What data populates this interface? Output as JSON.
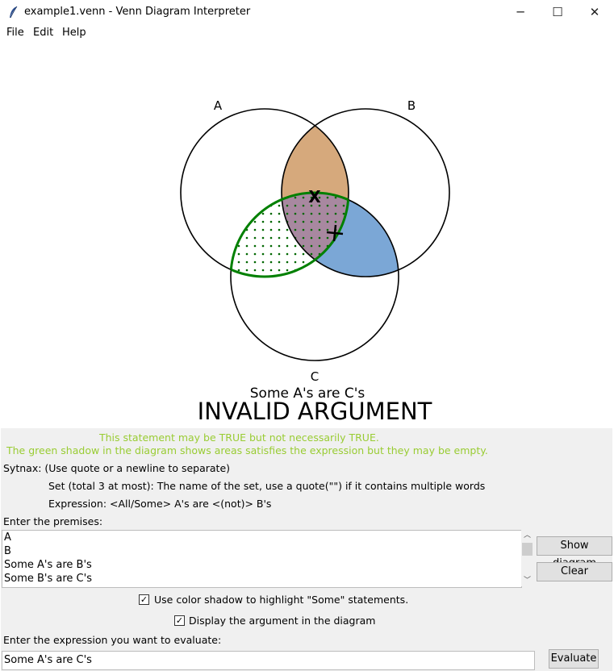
{
  "window": {
    "title": "example1.venn - Venn Diagram Interpreter",
    "controls": {
      "minimize": "─",
      "maximize": "☐",
      "close": "✕"
    }
  },
  "menu": [
    "File",
    "Edit",
    "Help"
  ],
  "diagram": {
    "set_labels": {
      "a": "A",
      "b": "B",
      "c": "C"
    },
    "markers": {
      "x": "X"
    },
    "expression": "Some A's are C's",
    "verdict": "INVALID ARGUMENT",
    "colors": {
      "ab_region": "#d6a97c",
      "bc_region": "#7ba7d6",
      "ac_shadow": "#008000",
      "ac_dots": "#006600",
      "abc_region": "#a888a0"
    }
  },
  "hints": {
    "line1": "This statement may be TRUE but not necessarily TRUE.",
    "line2": "The green shadow in the diagram shows areas satisfies the expression but they may be empty."
  },
  "syntax": {
    "title": "Sytnax: (Use quote or a newline to separate)",
    "set_rule": "Set (total 3 at most): The name of the set, use a quote(\"\") if it contains multiple words",
    "expr_rule": "Expression: <All/Some> A's are <(not)> B's"
  },
  "premises": {
    "label": "Enter the premises:",
    "lines": [
      "A",
      "B",
      "Some A's are B's",
      "Some B's are C's"
    ]
  },
  "buttons": {
    "show_diagram": "Show diagram",
    "clear": "Clear",
    "evaluate": "Evaluate"
  },
  "options": {
    "color_shadow": {
      "label": "Use color shadow to highlight \"Some\" statements.",
      "checked": true
    },
    "display_argument": {
      "label": "Display the argument in the diagram",
      "checked": true
    }
  },
  "evaluate": {
    "label": "Enter the expression you want to evaluate:",
    "value": "Some A's are C's"
  }
}
